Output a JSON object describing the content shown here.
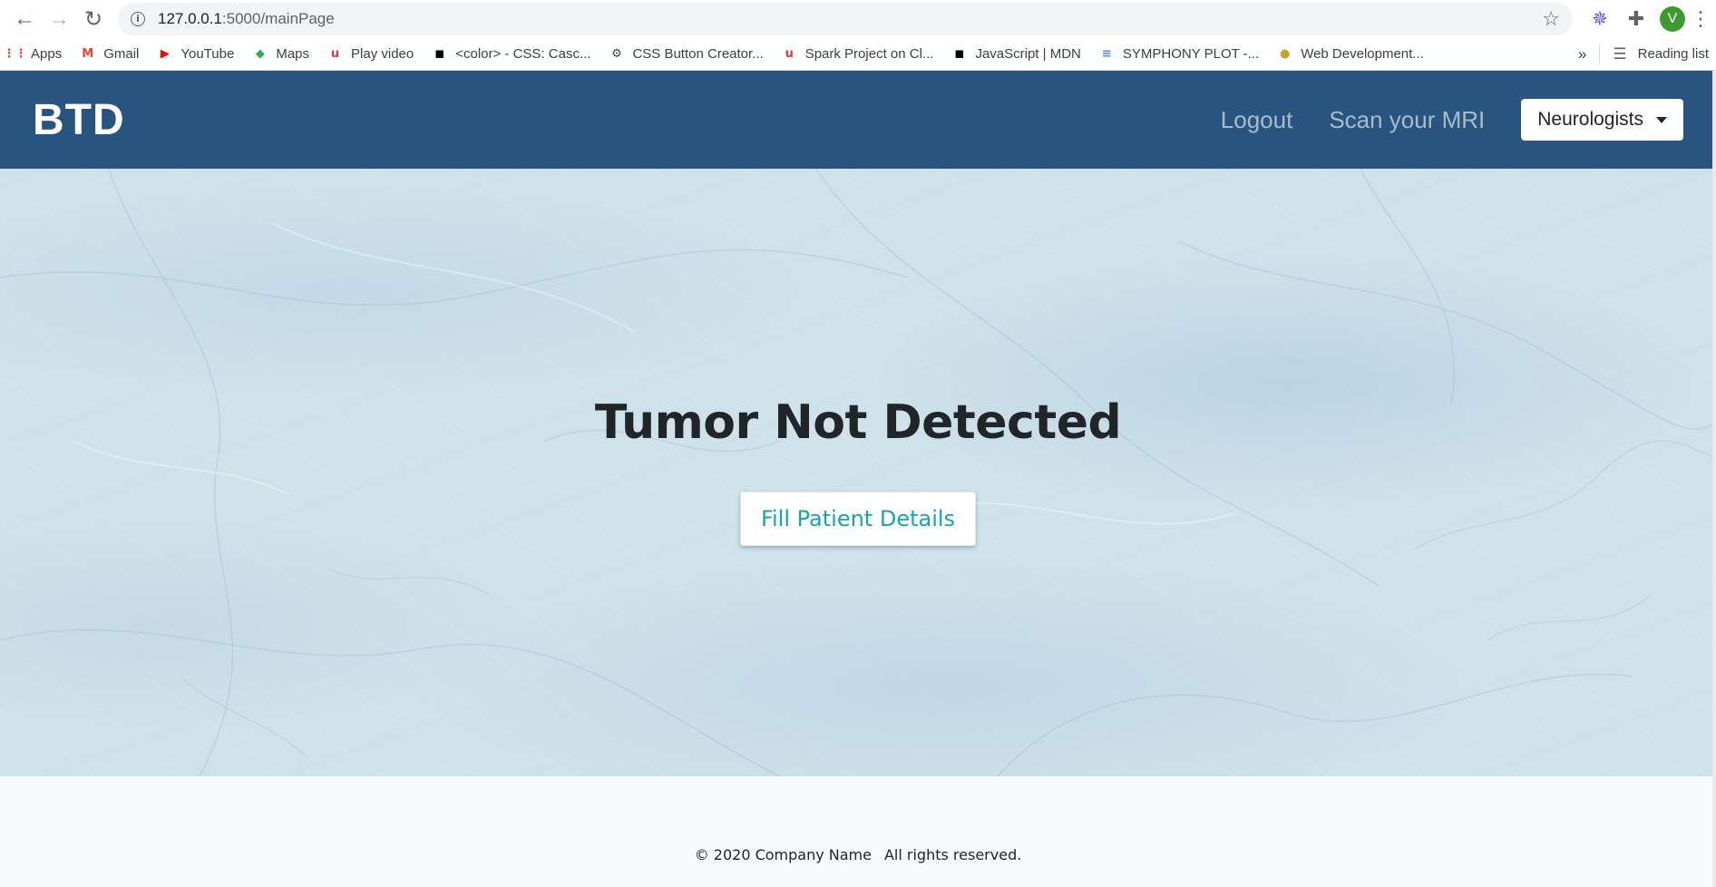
{
  "browser": {
    "url_host": "127.0.0.1",
    "url_path": ":5000/mainPage",
    "avatar_letter": "V",
    "bookmarks": [
      {
        "label": "Apps",
        "icon": "apps-grid-icon",
        "glyph": "⋮⋮",
        "color": "#ea4335"
      },
      {
        "label": "Gmail",
        "icon": "gmail-icon",
        "glyph": "M",
        "color": "#ea4335"
      },
      {
        "label": "YouTube",
        "icon": "youtube-icon",
        "glyph": "▶",
        "color": "#ff0000"
      },
      {
        "label": "Maps",
        "icon": "maps-icon",
        "glyph": "◆",
        "color": "#34a853"
      },
      {
        "label": "Play video",
        "icon": "udemy-icon",
        "glyph": "u",
        "color": "#e0393e"
      },
      {
        "label": "<color> - CSS: Casc...",
        "icon": "mdn-icon",
        "glyph": "◼",
        "color": "#000000"
      },
      {
        "label": "CSS Button Creator...",
        "icon": "gear-icon",
        "glyph": "⚙",
        "color": "#3c4043"
      },
      {
        "label": "Spark Project on Cl...",
        "icon": "udemy-icon",
        "glyph": "u",
        "color": "#e0393e"
      },
      {
        "label": "JavaScript | MDN",
        "icon": "mdn-icon",
        "glyph": "◼",
        "color": "#000000"
      },
      {
        "label": "SYMPHONY PLOT -...",
        "icon": "docs-icon",
        "glyph": "≡",
        "color": "#4285f4"
      },
      {
        "label": "Web Development...",
        "icon": "bulb-icon",
        "glyph": "●",
        "color": "#c9a227"
      }
    ],
    "more": "»",
    "reading_list": "Reading list"
  },
  "navbar": {
    "brand": "BTD",
    "links": [
      "Logout",
      "Scan your MRI"
    ],
    "dropdown_label": "Neurologists"
  },
  "hero": {
    "title": "Tumor Not Detected",
    "button_label": "Fill Patient Details"
  },
  "footer": {
    "copyright": "© 2020 Company Name",
    "rights": "All rights reserved."
  },
  "colors": {
    "navbar_bg": "#285480",
    "accent": "#17a2b8",
    "hero_bg": "#cfe2ea"
  }
}
